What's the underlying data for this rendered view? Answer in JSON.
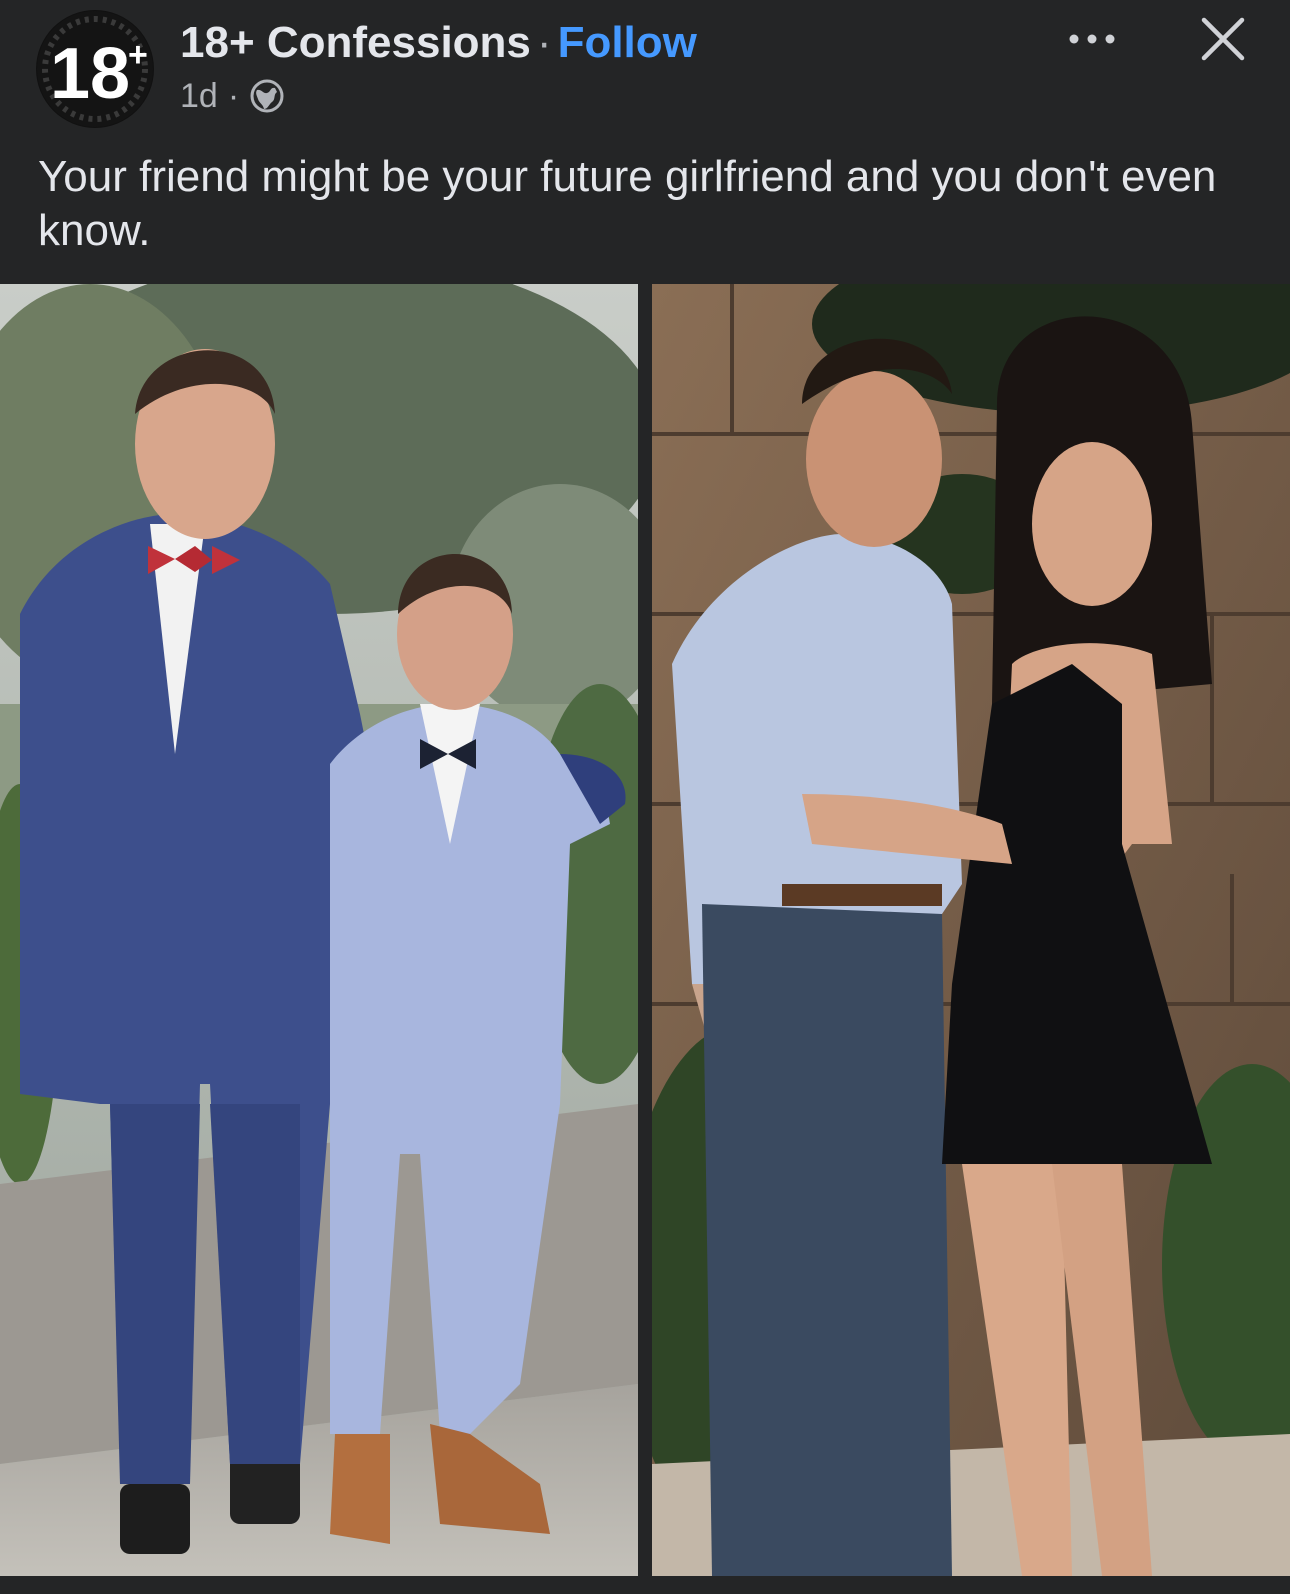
{
  "post": {
    "page_name": "18+ Confessions",
    "separator": "·",
    "follow_label": "Follow",
    "time": "1d",
    "meta_dot": "·",
    "audience_icon": "globe-icon",
    "caption": "Your friend might be your future girlfriend and you don't even know."
  },
  "avatar": {
    "logo_text": "18",
    "logo_plus": "+"
  },
  "header_actions": {
    "more_icon": "more-horizontal-icon",
    "close_icon": "close-icon"
  },
  "photos": {
    "left_desc_icon": "photo-then",
    "right_desc_icon": "photo-now"
  },
  "colors": {
    "background": "#242526",
    "text": "#e4e6eb",
    "secondary_text": "#b0b3b8",
    "follow": "#4599ff"
  }
}
